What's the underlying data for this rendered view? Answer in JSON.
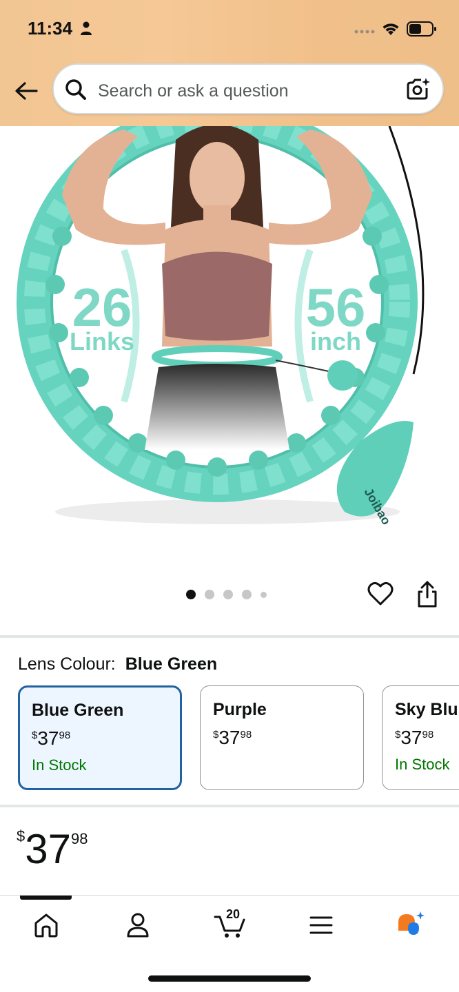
{
  "status_bar": {
    "time": "11:34"
  },
  "search": {
    "placeholder": "Search or ask a question"
  },
  "product_image": {
    "left_badge_number": "26",
    "left_badge_text": "Links",
    "right_badge_number": "56",
    "right_badge_text": "inch",
    "brand_text": "Joibao"
  },
  "carousel": {
    "count": 5,
    "active_index": 0
  },
  "variant": {
    "label": "Lens Colour:",
    "selected_value": "Blue Green",
    "options": [
      {
        "name": "Blue Green",
        "currency": "$",
        "whole": "37",
        "fraction": "98",
        "stock": "In Stock",
        "selected": true
      },
      {
        "name": "Purple",
        "currency": "$",
        "whole": "37",
        "fraction": "98",
        "stock": "",
        "selected": false
      },
      {
        "name": "Sky Blu",
        "currency": "$",
        "whole": "37",
        "fraction": "98",
        "stock": "In Stock",
        "selected": false
      }
    ]
  },
  "price": {
    "currency": "$",
    "whole": "37",
    "fraction": "98"
  },
  "bottom_nav": {
    "items": [
      "home-icon",
      "account-icon",
      "cart-icon",
      "menu-icon",
      "rufus-ai-icon"
    ],
    "cart_count": "20",
    "active_index": 0
  },
  "colors": {
    "header_bg": "#f2c692",
    "hoop_teal": "#6fd8c4",
    "selected_border": "#2162a1",
    "selected_bg": "#edf6ff",
    "in_stock_green": "#007600"
  }
}
